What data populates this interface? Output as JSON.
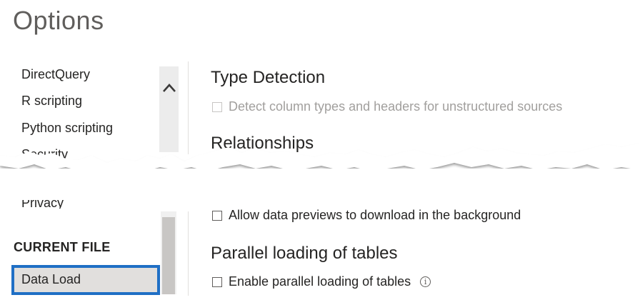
{
  "dialog": {
    "title": "Options"
  },
  "nav": {
    "global_items": [
      {
        "label": "DirectQuery"
      },
      {
        "label": "R scripting"
      },
      {
        "label": "Python scripting"
      },
      {
        "label": "Security"
      }
    ],
    "partial_item": "Privacy",
    "current_file_header": "CURRENT FILE",
    "selected_item": "Data Load"
  },
  "content": {
    "type_detection": {
      "heading": "Type Detection",
      "checkbox_label": "Detect column types and headers for unstructured sources",
      "checked": false,
      "disabled": true
    },
    "relationships": {
      "heading": "Relationships"
    },
    "background_data": {
      "checkbox_label": "Allow data previews to download in the background",
      "checked": false
    },
    "parallel_loading": {
      "heading": "Parallel loading of tables",
      "checkbox_label": "Enable parallel loading of tables",
      "checked": false
    }
  },
  "colors": {
    "selection_border": "#1f6fc5",
    "selected_bg": "#e1dfdd"
  },
  "icons": [
    "chevron-up-icon",
    "info-icon"
  ]
}
